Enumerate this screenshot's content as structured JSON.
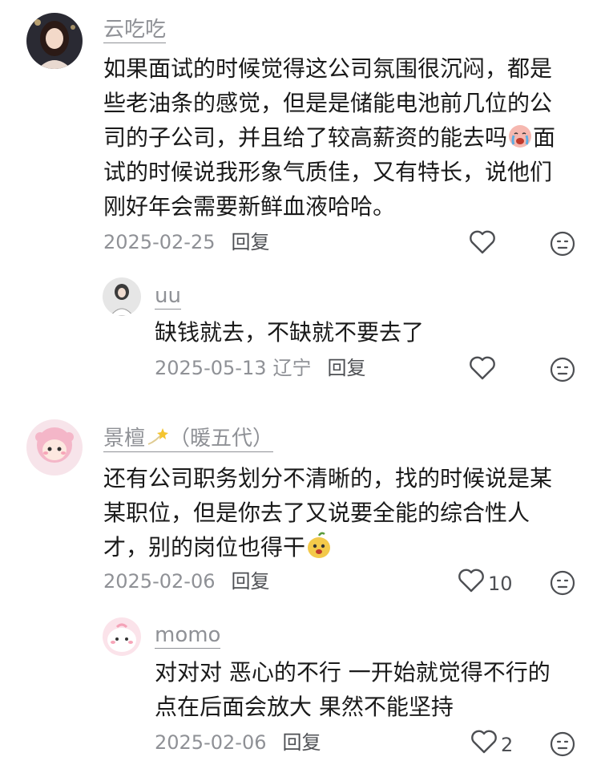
{
  "comments": [
    {
      "username": "云吃吃",
      "text": "如果面试的时候觉得这公司氛围很沉闷，都是些老油条的感觉，但是是储能电池前几位的公司的子公司，并且给了较高薪资的能去吗",
      "text_after_emoji": "面试的时候说我形象气质佳，又有特长，说他们刚好年会需要新鲜血液哈哈。",
      "inline_emoji": "crying-face-emoji",
      "date": "2025-02-25",
      "reply_label": "回复",
      "likes": ""
    },
    {
      "username": "uu",
      "text": "缺钱就去，不缺就不要去了",
      "date": "2025-05-13",
      "region": "辽宁",
      "reply_label": "回复",
      "likes": ""
    },
    {
      "username": "景檀",
      "username_suffix": "（暖五代）",
      "username_emoji": "dizzy-star-emoji",
      "text": "还有公司职务划分不清晰的，找的时候说是某某职位，但是你去了又说要全能的综合性人才，别的岗位也得干",
      "inline_emoji": "mango-face-emoji",
      "date": "2025-02-06",
      "reply_label": "回复",
      "likes": "10"
    },
    {
      "username": "momo",
      "text": "对对对 恶心的不行 一开始就觉得不行的点在后面会放大 果然不能坚持",
      "date": "2025-02-06",
      "reply_label": "回复",
      "likes": "2"
    }
  ],
  "icons": {
    "like": "heart-outline-icon",
    "reaction": "neutral-face-icon"
  },
  "colors": {
    "text": "#1a1a1a",
    "meta": "#8f9196",
    "icon": "#4d4f53"
  }
}
